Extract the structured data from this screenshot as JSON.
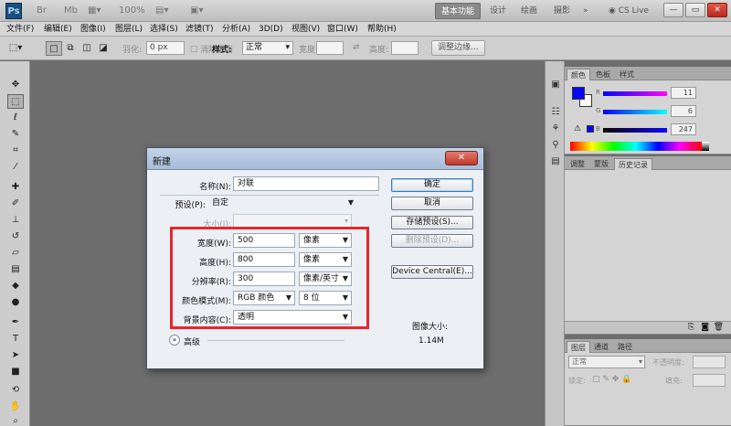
{
  "titlebar": {
    "logo": "Ps",
    "zoom": "100%",
    "workspaces": [
      "基本功能",
      "设计",
      "绘画",
      "摄影"
    ],
    "more": "»",
    "cslive": "CS Live",
    "window_controls": {
      "minimize": "—",
      "restore": "▭",
      "close": "✕"
    }
  },
  "menu": [
    "文件(F)",
    "编辑(E)",
    "图像(I)",
    "图层(L)",
    "选择(S)",
    "滤镜(T)",
    "分析(A)",
    "3D(D)",
    "视图(V)",
    "窗口(W)",
    "帮助(H)"
  ],
  "options": {
    "feather_label": "羽化:",
    "feather_value": "0 px",
    "antialias_label": "消除锯齿",
    "style_label": "样式:",
    "style_value": "正常",
    "width_label": "宽度:",
    "height_label": "高度:",
    "refine_button": "调整边缘..."
  },
  "panels": {
    "color_tabs": [
      "颜色",
      "色板",
      "样式"
    ],
    "color_channels": [
      {
        "letter": "R",
        "value": "11"
      },
      {
        "letter": "G",
        "value": "6"
      },
      {
        "letter": "B",
        "value": "247"
      }
    ],
    "foreground_color": "#0b06f7",
    "history_tabs": [
      "调整",
      "蒙版",
      "历史记录"
    ],
    "layers_tabs": [
      "图层",
      "通道",
      "路径"
    ],
    "blend_mode": "正常",
    "opacity_label": "不透明度:",
    "lock_label": "锁定:",
    "fill_label": "填充:"
  },
  "dialog": {
    "title": "新建",
    "name_label": "名称(N):",
    "name_value": "对联",
    "preset_label": "预设(P):",
    "preset_value": "自定",
    "size_label": "大小(I):",
    "width_label": "宽度(W):",
    "width_value": "500",
    "width_unit": "像素",
    "height_label": "高度(H):",
    "height_value": "800",
    "height_unit": "像素",
    "resolution_label": "分辨率(R):",
    "resolution_value": "300",
    "resolution_unit": "像素/英寸",
    "color_mode_label": "颜色模式(M):",
    "color_mode_value": "RGB 颜色",
    "bit_depth_value": "8 位",
    "background_label": "背景内容(C):",
    "background_value": "透明",
    "advanced_label": "高级",
    "image_size_label": "图像大小:",
    "image_size_value": "1.14M",
    "buttons": {
      "ok": "确定",
      "cancel": "取消",
      "save_preset": "存储预设(S)...",
      "delete_preset": "删除预设(D)...",
      "device_central": "Device Central(E)..."
    },
    "highlight_color": "#e8262e"
  }
}
